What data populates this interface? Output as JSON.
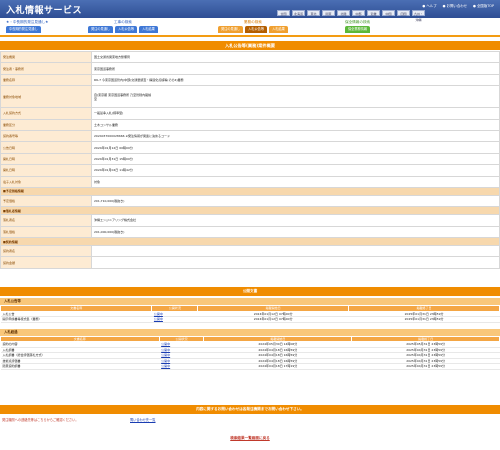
{
  "app": {
    "title": "入札情報サービス"
  },
  "header_links": [
    "● ヘルプ",
    "● お問い合わせ",
    "● 全国版TOP"
  ],
  "regions": [
    "全国",
    "北海道",
    "東北",
    "関東",
    "北陸",
    "中部",
    "近畿",
    "中国",
    "四国",
    "九州・沖縄"
  ],
  "nav": {
    "groups": [
      {
        "title": "★・中長期的発注見通し★",
        "buttons": [
          "中長期的発注見通し"
        ]
      },
      {
        "title": "工事の検索",
        "buttons": [
          "発注の見通し",
          "入札公告等",
          "入札結果"
        ]
      },
      {
        "title": "業務の検索",
        "buttons": [
          "発注の見通し",
          "入札公告等",
          "入札結果"
        ]
      },
      {
        "title": "保全情報の検索",
        "buttons": [
          "保全業務情報"
        ]
      }
    ]
  },
  "page_title": "入札公告等(業務)案件概要",
  "detail_rows": [
    {
      "label": "発注機関",
      "value": "国土交通省関東地方整備局"
    },
    {
      "label": "発注者・事務所",
      "value": "東京国道事務所"
    },
    {
      "label": "業務名称",
      "value": "R6-7 今東京国道管内(中部)交通量調査・構造化点検等(その4)業務"
    },
    {
      "label": "業務対象地域",
      "value": "自)東京都 東京国道事務所 乃至管轄内路線\n至"
    },
    {
      "label": "入札契約方式",
      "value": "一般競争入札(標準型)"
    },
    {
      "label": "業務区分",
      "value": "土木コンサル業務"
    },
    {
      "label": "契約番号等",
      "value": "2024037000028666 ※発注情報が関連に決めるコード"
    },
    {
      "label": "公告日時",
      "value": "2024年01月12日 00時00分"
    },
    {
      "label": "開札日時",
      "value": "2024年01月31日 15時00分"
    },
    {
      "label": "開札日時",
      "value": "2024年01月04日 11時42分"
    },
    {
      "label": "電子入札対象",
      "value": "対象"
    }
  ],
  "price_section": {
    "title": "■予定価格情報",
    "label": "予定価格",
    "value": "201,710,000(税抜き)"
  },
  "winner_section": {
    "title": "■落札者情報",
    "rows": [
      {
        "label": "落札者名",
        "value": "沖縄エンジニアリング株式会社"
      },
      {
        "label": "落札価格",
        "value": "201,000,000(税抜き)"
      }
    ]
  },
  "contract_section": {
    "title": "■契約情報",
    "rows": [
      {
        "label": "契約者名",
        "value": ""
      },
      {
        "label": "契約金額",
        "value": ""
      }
    ]
  },
  "docs": {
    "title": "公開文書",
    "notice_title": "入札公告等",
    "headers": [
      "文書名称",
      "公開状況",
      "掲載開始日",
      "掲載終了日"
    ],
    "notice_rows": [
      {
        "name": "入札公告",
        "status": "公開中",
        "start": "2024年01月12日 07時00分",
        "end": "2025年01月31日 23時59分"
      },
      {
        "name": "開示申請書等様式集（業務）",
        "status": "公開中",
        "start": "2024年01月12日 07時00分",
        "end": "2025年01月31日 23時59分"
      }
    ],
    "result_title": "入札経過",
    "result_rows": [
      {
        "name": "契約の内容",
        "status": "公開中",
        "start": "2024年05月30日 14時06分",
        "end": "2025年05月31日 23時59分"
      },
      {
        "name": "入札調書",
        "status": "公開中",
        "start": "2024年04月18日 16時59分",
        "end": "2025年04月31日 23時59分"
      },
      {
        "name": "入札調書（総合評価落札方式）",
        "status": "公開中",
        "start": "2024年04月18日 16時59分",
        "end": "2025年04月31日 23時59分"
      },
      {
        "name": "技術点評価書",
        "status": "公開中",
        "start": "2024年04月18日 16時59分",
        "end": "2025年04月31日 23時59分"
      },
      {
        "name": "随意契約調書",
        "status": "公開中",
        "start": "2024年04月18日 17時19分",
        "end": "2025年04月31日 23時59分"
      }
    ]
  },
  "inquiry": {
    "title": "内容に関するお問い合わせは各発注機関までお問い合わせ下さい。",
    "note": "発注機関への連絡先等はこちらからご確認ください。",
    "link": "問い合わせ先一覧"
  },
  "back_link": "検索結果一覧画面に戻る",
  "colors": {
    "header": "#2e4e94",
    "accent": "#f08c00",
    "label_bg": "#fdebd3"
  }
}
